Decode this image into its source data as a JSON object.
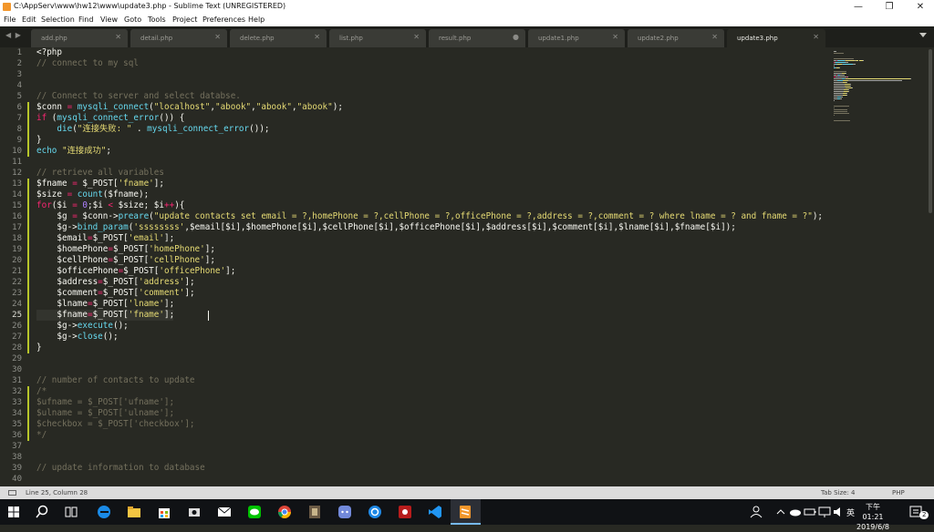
{
  "window": {
    "title": "C:\\AppServ\\www\\hw12\\www\\update3.php - Sublime Text (UNREGISTERED)",
    "min_label": "—",
    "max_label": "❐",
    "close_label": "✕"
  },
  "menu": [
    "File",
    "Edit",
    "Selection",
    "Find",
    "View",
    "Goto",
    "Tools",
    "Project",
    "Preferences",
    "Help"
  ],
  "tabs": [
    {
      "label": "add.php",
      "close": "✕"
    },
    {
      "label": "detail.php",
      "close": "✕"
    },
    {
      "label": "delete.php",
      "close": "✕"
    },
    {
      "label": "list.php",
      "close": "✕"
    },
    {
      "label": "result.php",
      "close": "●"
    },
    {
      "label": "update1.php",
      "close": "✕"
    },
    {
      "label": "update2.php",
      "close": "✕"
    },
    {
      "label": "update3.php",
      "close": "✕"
    }
  ],
  "nav_arrows": "◀ ▶",
  "line_numbers": [
    "1",
    "2",
    "3",
    "4",
    "5",
    "6",
    "7",
    "8",
    "9",
    "10",
    "11",
    "12",
    "13",
    "14",
    "15",
    "16",
    "17",
    "18",
    "19",
    "20",
    "21",
    "22",
    "23",
    "24",
    "25",
    "26",
    "27",
    "28",
    "29",
    "30",
    "31",
    "32",
    "33",
    "34",
    "35",
    "36",
    "37",
    "38",
    "39",
    "40"
  ],
  "status": {
    "position": "Line 25, Column 28",
    "tab_size": "Tab Size: 4",
    "syntax": "PHP"
  },
  "clock": {
    "time": "下午 01:21",
    "date": "2019/6/8"
  },
  "tray": {
    "lang": "英",
    "notif": "2"
  },
  "colors": {
    "keyword": "#f92672",
    "string": "#e6db74",
    "function": "#66d9ef",
    "comment": "#75715e",
    "number": "#ae81ff",
    "modified": "#b7c62a"
  }
}
